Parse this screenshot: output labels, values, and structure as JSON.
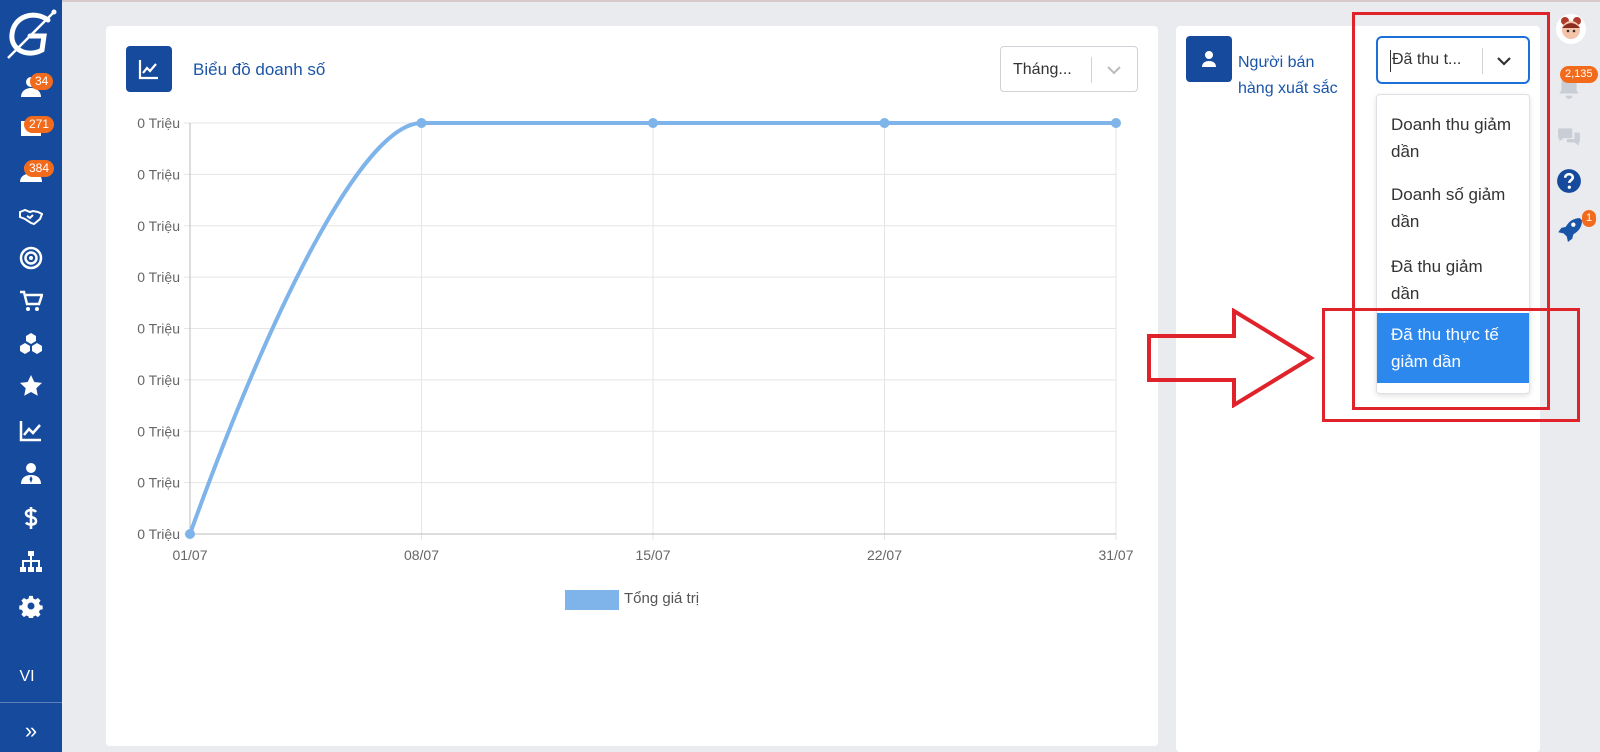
{
  "sidebar": {
    "badges": {
      "contacts": "34",
      "mail": "271",
      "users": "384"
    },
    "language": "VI",
    "expand_glyph": "»"
  },
  "chart_card": {
    "title": "Biểu đồ doanh số",
    "period_select": {
      "value": "Tháng..."
    }
  },
  "chart_data": {
    "type": "line",
    "x": [
      "01/07",
      "08/07",
      "15/07",
      "22/07",
      "31/07"
    ],
    "y_tick_labels": [
      "0 Triệu",
      "0 Triệu",
      "0 Triệu",
      "0 Triệu",
      "0 Triệu",
      "0 Triệu",
      "0 Triệu",
      "0 Triệu",
      "0 Triệu"
    ],
    "series": [
      {
        "name": "Tổng giá trị",
        "values": [
          0,
          1,
          1,
          1,
          1
        ],
        "color": "#7fb4ea"
      }
    ],
    "legend": "bottom-center",
    "grid": true
  },
  "seller_card": {
    "title": "Người bán hàng xuất sắc",
    "sort_select": {
      "value": "Đã thu t..."
    },
    "options": [
      {
        "label": "Doanh thu giảm dần",
        "selected": false
      },
      {
        "label": "Doanh số giảm dần",
        "selected": false
      },
      {
        "label": "Đã thu giảm dần",
        "selected": false
      },
      {
        "label": "Đã thu thực tế giảm dần",
        "selected": true
      }
    ]
  },
  "right_bar": {
    "notification_count": "2,135",
    "rocket_count": "1"
  },
  "colors": {
    "sidebar": "#164a9c",
    "accent": "#1a55a8",
    "line": "#7fb4ea",
    "selected": "#2d88ee",
    "annotation": "#e0222a",
    "badge": "#f26b1d"
  }
}
